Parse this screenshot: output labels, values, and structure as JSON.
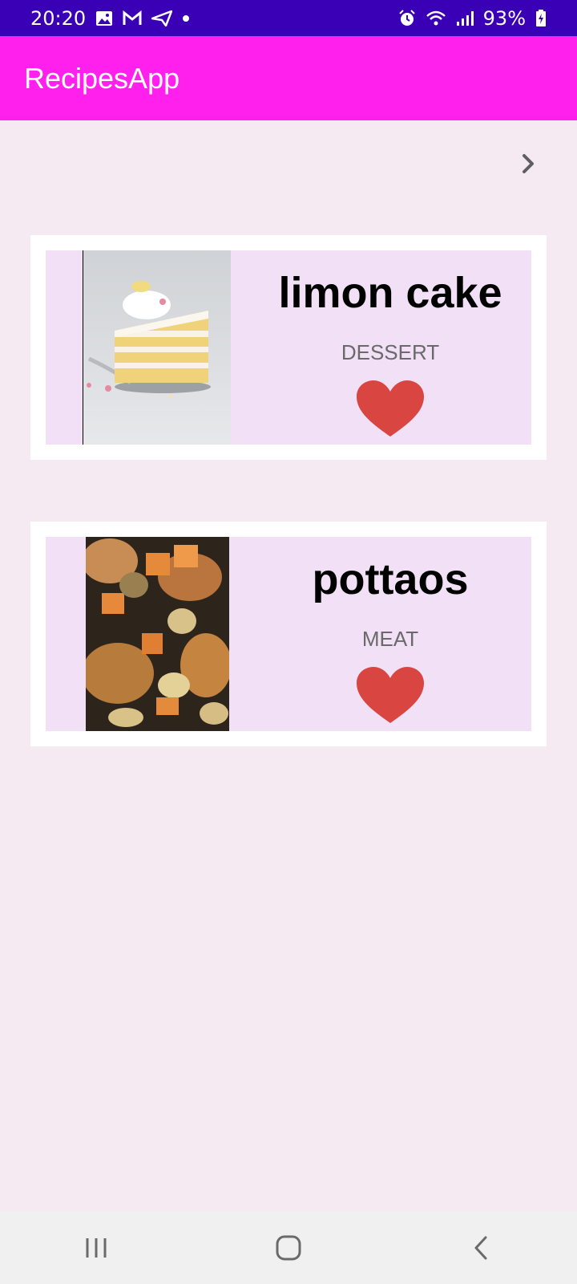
{
  "status_bar": {
    "time": "20:20",
    "battery": "93%",
    "icons_left": [
      "image-icon",
      "gmail-icon",
      "send-icon",
      "dot-icon"
    ],
    "icons_right": [
      "alarm-icon",
      "wifi-icon",
      "signal-icon",
      "battery-icon"
    ]
  },
  "app_bar": {
    "title": "RecipesApp"
  },
  "colors": {
    "status_bar": "#3900b5",
    "app_bar": "#ff20ee",
    "background": "#f5e9f2",
    "card_inner": "#f1e0f6",
    "heart": "#d94540"
  },
  "recipes": [
    {
      "title": "limon cake",
      "category": "DESSERT",
      "image_icon": "cake-image",
      "favorite": true
    },
    {
      "title": "pottaos",
      "category": "MEAT",
      "image_icon": "roast-chicken-potatoes-image",
      "favorite": true
    }
  ],
  "nav": {
    "buttons": [
      "recent-apps-icon",
      "home-icon",
      "back-icon"
    ]
  }
}
